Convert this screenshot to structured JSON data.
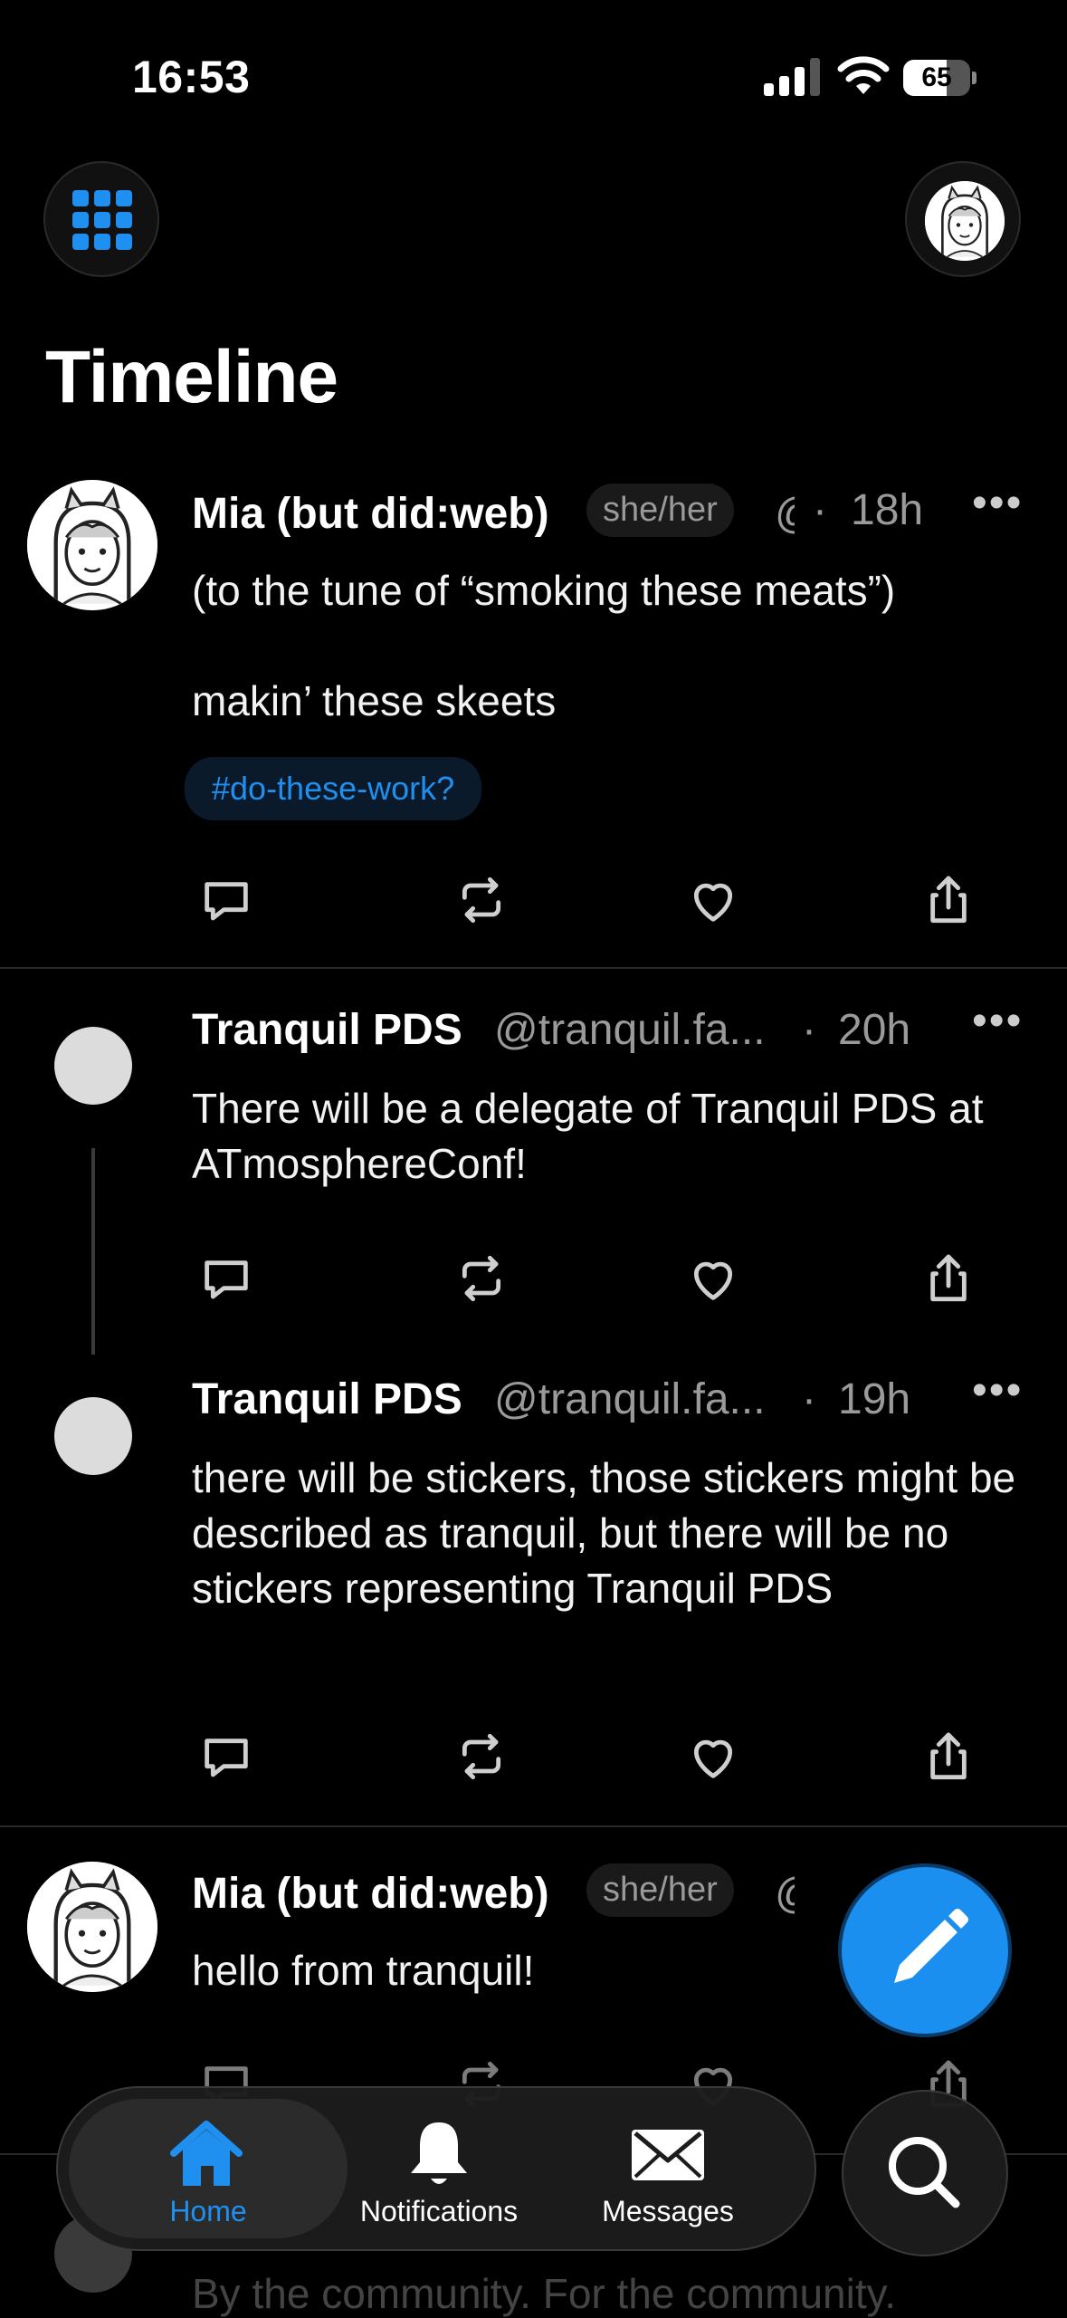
{
  "status_bar": {
    "time": "16:53",
    "battery": "65",
    "battery_level": 0.65
  },
  "header": {
    "title": "Timeline"
  },
  "posts": [
    {
      "name": "Mia (but did:web)",
      "pronouns": "she/her",
      "handle": "@",
      "time": "18h",
      "text_line1": "(to the tune of “smoking these meats”)",
      "text_line2": "makin’ these skeets",
      "hashtag": "#do-these-work?"
    },
    {
      "name": "Tranquil PDS",
      "handle": "@tranquil.fa...",
      "time": "20h",
      "text": "There will be a delegate of Tranquil PDS at ATmosphereConf!"
    },
    {
      "name": "Tranquil PDS",
      "handle": "@tranquil.fa...",
      "time": "19h",
      "text": "there will be stickers, those stickers might be described as tranquil, but there will be no stickers representing Tranquil PDS"
    },
    {
      "name": "Mia (but did:web)",
      "pronouns": "she/her",
      "handle": "@",
      "text": "hello from tranquil!"
    }
  ],
  "partial_post": {
    "text": "By the community. For the community."
  },
  "tabs": [
    {
      "label": "Home",
      "icon": "home-icon",
      "active": true
    },
    {
      "label": "Notifications",
      "icon": "bell-icon"
    },
    {
      "label": "Messages",
      "icon": "envelope-icon"
    }
  ],
  "colors": {
    "accent": "#1f8ff0",
    "background": "#000000",
    "muted": "#9a9a9a"
  },
  "icons": [
    "grid-icon",
    "avatar",
    "reply-icon",
    "repost-icon",
    "like-icon",
    "share-icon",
    "compose-icon",
    "search-icon"
  ]
}
